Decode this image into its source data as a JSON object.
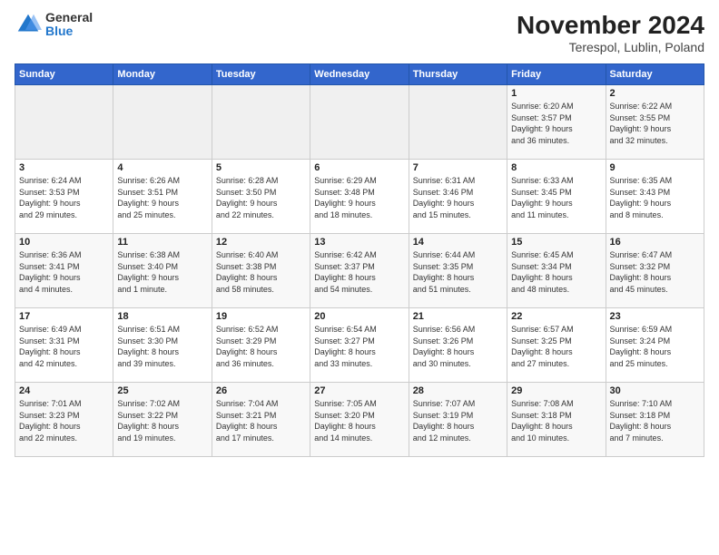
{
  "header": {
    "logo": {
      "general": "General",
      "blue": "Blue"
    },
    "title": "November 2024",
    "subtitle": "Terespol, Lublin, Poland"
  },
  "days_of_week": [
    "Sunday",
    "Monday",
    "Tuesday",
    "Wednesday",
    "Thursday",
    "Friday",
    "Saturday"
  ],
  "weeks": [
    [
      {
        "day": "",
        "info": ""
      },
      {
        "day": "",
        "info": ""
      },
      {
        "day": "",
        "info": ""
      },
      {
        "day": "",
        "info": ""
      },
      {
        "day": "",
        "info": ""
      },
      {
        "day": "1",
        "info": "Sunrise: 6:20 AM\nSunset: 3:57 PM\nDaylight: 9 hours\nand 36 minutes."
      },
      {
        "day": "2",
        "info": "Sunrise: 6:22 AM\nSunset: 3:55 PM\nDaylight: 9 hours\nand 32 minutes."
      }
    ],
    [
      {
        "day": "3",
        "info": "Sunrise: 6:24 AM\nSunset: 3:53 PM\nDaylight: 9 hours\nand 29 minutes."
      },
      {
        "day": "4",
        "info": "Sunrise: 6:26 AM\nSunset: 3:51 PM\nDaylight: 9 hours\nand 25 minutes."
      },
      {
        "day": "5",
        "info": "Sunrise: 6:28 AM\nSunset: 3:50 PM\nDaylight: 9 hours\nand 22 minutes."
      },
      {
        "day": "6",
        "info": "Sunrise: 6:29 AM\nSunset: 3:48 PM\nDaylight: 9 hours\nand 18 minutes."
      },
      {
        "day": "7",
        "info": "Sunrise: 6:31 AM\nSunset: 3:46 PM\nDaylight: 9 hours\nand 15 minutes."
      },
      {
        "day": "8",
        "info": "Sunrise: 6:33 AM\nSunset: 3:45 PM\nDaylight: 9 hours\nand 11 minutes."
      },
      {
        "day": "9",
        "info": "Sunrise: 6:35 AM\nSunset: 3:43 PM\nDaylight: 9 hours\nand 8 minutes."
      }
    ],
    [
      {
        "day": "10",
        "info": "Sunrise: 6:36 AM\nSunset: 3:41 PM\nDaylight: 9 hours\nand 4 minutes."
      },
      {
        "day": "11",
        "info": "Sunrise: 6:38 AM\nSunset: 3:40 PM\nDaylight: 9 hours\nand 1 minute."
      },
      {
        "day": "12",
        "info": "Sunrise: 6:40 AM\nSunset: 3:38 PM\nDaylight: 8 hours\nand 58 minutes."
      },
      {
        "day": "13",
        "info": "Sunrise: 6:42 AM\nSunset: 3:37 PM\nDaylight: 8 hours\nand 54 minutes."
      },
      {
        "day": "14",
        "info": "Sunrise: 6:44 AM\nSunset: 3:35 PM\nDaylight: 8 hours\nand 51 minutes."
      },
      {
        "day": "15",
        "info": "Sunrise: 6:45 AM\nSunset: 3:34 PM\nDaylight: 8 hours\nand 48 minutes."
      },
      {
        "day": "16",
        "info": "Sunrise: 6:47 AM\nSunset: 3:32 PM\nDaylight: 8 hours\nand 45 minutes."
      }
    ],
    [
      {
        "day": "17",
        "info": "Sunrise: 6:49 AM\nSunset: 3:31 PM\nDaylight: 8 hours\nand 42 minutes."
      },
      {
        "day": "18",
        "info": "Sunrise: 6:51 AM\nSunset: 3:30 PM\nDaylight: 8 hours\nand 39 minutes."
      },
      {
        "day": "19",
        "info": "Sunrise: 6:52 AM\nSunset: 3:29 PM\nDaylight: 8 hours\nand 36 minutes."
      },
      {
        "day": "20",
        "info": "Sunrise: 6:54 AM\nSunset: 3:27 PM\nDaylight: 8 hours\nand 33 minutes."
      },
      {
        "day": "21",
        "info": "Sunrise: 6:56 AM\nSunset: 3:26 PM\nDaylight: 8 hours\nand 30 minutes."
      },
      {
        "day": "22",
        "info": "Sunrise: 6:57 AM\nSunset: 3:25 PM\nDaylight: 8 hours\nand 27 minutes."
      },
      {
        "day": "23",
        "info": "Sunrise: 6:59 AM\nSunset: 3:24 PM\nDaylight: 8 hours\nand 25 minutes."
      }
    ],
    [
      {
        "day": "24",
        "info": "Sunrise: 7:01 AM\nSunset: 3:23 PM\nDaylight: 8 hours\nand 22 minutes."
      },
      {
        "day": "25",
        "info": "Sunrise: 7:02 AM\nSunset: 3:22 PM\nDaylight: 8 hours\nand 19 minutes."
      },
      {
        "day": "26",
        "info": "Sunrise: 7:04 AM\nSunset: 3:21 PM\nDaylight: 8 hours\nand 17 minutes."
      },
      {
        "day": "27",
        "info": "Sunrise: 7:05 AM\nSunset: 3:20 PM\nDaylight: 8 hours\nand 14 minutes."
      },
      {
        "day": "28",
        "info": "Sunrise: 7:07 AM\nSunset: 3:19 PM\nDaylight: 8 hours\nand 12 minutes."
      },
      {
        "day": "29",
        "info": "Sunrise: 7:08 AM\nSunset: 3:18 PM\nDaylight: 8 hours\nand 10 minutes."
      },
      {
        "day": "30",
        "info": "Sunrise: 7:10 AM\nSunset: 3:18 PM\nDaylight: 8 hours\nand 7 minutes."
      }
    ]
  ]
}
